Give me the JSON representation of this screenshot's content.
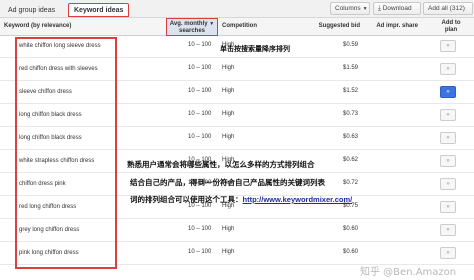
{
  "tabs": [
    {
      "label": "Ad group ideas"
    },
    {
      "label": "Keyword ideas"
    }
  ],
  "toolbar": {
    "columns_label": "Columns",
    "download_label": "Download",
    "add_all_label": "Add all (312)"
  },
  "table": {
    "headers": {
      "keyword": "Keyword (by relevance)",
      "avg_line1": "Avg. monthly",
      "avg_line2": "searches",
      "competition": "Competition",
      "bid": "Suggested bid",
      "share": "Ad impr. share",
      "plan_line1": "Add to",
      "plan_line2": "plan"
    },
    "rows": [
      {
        "keyword": "white chiffon long sleeve dress",
        "searches": "10 – 100",
        "competition": "High",
        "bid": "$0.59",
        "added": false
      },
      {
        "keyword": "red chiffon dress with sleeves",
        "searches": "10 – 100",
        "competition": "High",
        "bid": "$1.59",
        "added": false
      },
      {
        "keyword": "sleeve chiffon dress",
        "searches": "10 – 100",
        "competition": "High",
        "bid": "$1.52",
        "added": true
      },
      {
        "keyword": "long chiffon black dress",
        "searches": "10 – 100",
        "competition": "High",
        "bid": "$0.73",
        "added": false
      },
      {
        "keyword": "long chiffon black dress",
        "searches": "10 – 100",
        "competition": "High",
        "bid": "$0.63",
        "added": false
      },
      {
        "keyword": "white strapless chiffon dress",
        "searches": "10 – 100",
        "competition": "High",
        "bid": "$0.62",
        "added": false
      },
      {
        "keyword": "chiffon dress pink",
        "searches": "10 – 100",
        "competition": "High",
        "bid": "$0.72",
        "added": false
      },
      {
        "keyword": "red long chiffon dress",
        "searches": "10 – 100",
        "competition": "High",
        "bid": "$0.75",
        "added": false
      },
      {
        "keyword": "grey long chiffon dress",
        "searches": "10 – 100",
        "competition": "High",
        "bid": "$0.60",
        "added": false
      },
      {
        "keyword": "pink long chiffon dress",
        "searches": "10 – 100",
        "competition": "High",
        "bid": "$0.60",
        "added": false
      }
    ]
  },
  "annotations": {
    "sort_note": "单击按搜索量降序排列",
    "line1": "熟悉用户通常会将哪些属性，以怎么多样的方式排列组合",
    "line2": "结合自己的产品，得到一份符合自己产品属性的关键词列表",
    "line3_prefix": "词的排列组合可以使用这个工具：",
    "line3_link": "http://www.keywordmixer.com/"
  },
  "watermark": "知乎 @Ben.Amazon",
  "colors": {
    "highlight": "#e23b3b",
    "add_active": "#3b74e0",
    "link": "#1a2ea0"
  }
}
